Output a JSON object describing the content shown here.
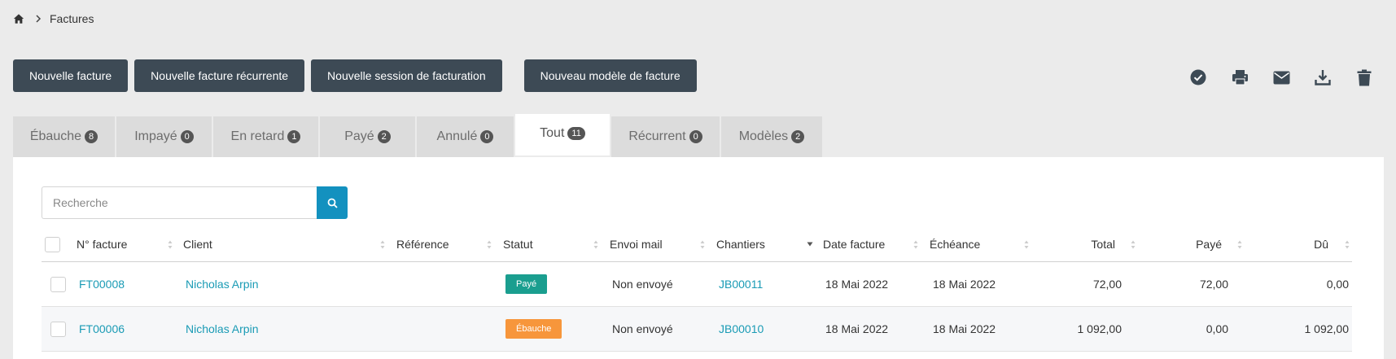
{
  "breadcrumb": {
    "current": "Factures"
  },
  "toolbar": {
    "new_invoice": "Nouvelle facture",
    "new_recurring": "Nouvelle facture récurrente",
    "new_session": "Nouvelle session de facturation",
    "new_template": "Nouveau modèle de facture"
  },
  "actions": [
    "check-circle-icon",
    "print-icon",
    "mail-icon",
    "download-icon",
    "trash-icon"
  ],
  "tabs": [
    {
      "label": "Ébauche",
      "count": "8"
    },
    {
      "label": "Impayé",
      "count": "0"
    },
    {
      "label": "En retard",
      "count": "1"
    },
    {
      "label": "Payé",
      "count": "2"
    },
    {
      "label": "Annulé",
      "count": "0"
    },
    {
      "label": "Tout",
      "count": "11"
    },
    {
      "label": "Récurrent",
      "count": "0"
    },
    {
      "label": "Modèles",
      "count": "2"
    }
  ],
  "search": {
    "placeholder": "Recherche"
  },
  "table": {
    "headers": {
      "number": "N° facture",
      "client": "Client",
      "reference": "Référence",
      "status": "Statut",
      "mail": "Envoi mail",
      "sites": "Chantiers",
      "date": "Date facture",
      "due_date": "Échéance",
      "total": "Total",
      "paid": "Payé",
      "due": "Dû"
    },
    "rows": [
      {
        "number": "FT00008",
        "client": "Nicholas Arpin",
        "reference": "",
        "status": "Payé",
        "status_color": "#1a9e8f",
        "mail": "Non envoyé",
        "site": "JB00011",
        "date": "18 Mai 2022",
        "due_date": "18 Mai 2022",
        "total": "72,00",
        "paid": "72,00",
        "due": "0,00"
      },
      {
        "number": "FT00006",
        "client": "Nicholas Arpin",
        "reference": "",
        "status": "Ébauche",
        "status_color": "#f7963b",
        "mail": "Non envoyé",
        "site": "JB00010",
        "date": "18 Mai 2022",
        "due_date": "18 Mai 2022",
        "total": "1 092,00",
        "paid": "0,00",
        "due": "1 092,00"
      }
    ]
  },
  "colors": {
    "button": "#3d4a55",
    "accent": "#1391bf",
    "link": "#1a9bb5"
  }
}
